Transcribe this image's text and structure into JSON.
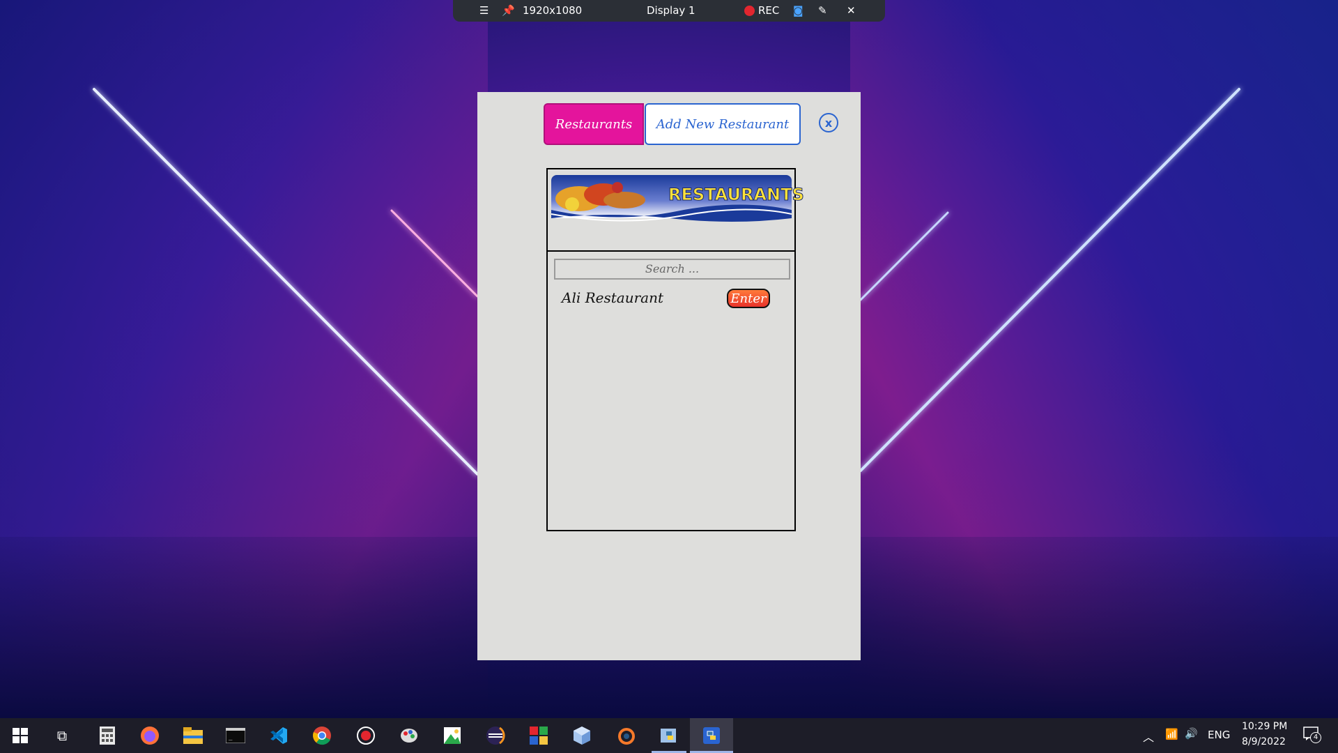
{
  "capture_bar": {
    "menu_icon": "hamburger-icon",
    "pin_icon": "pin-icon",
    "resolution": "1920x1080",
    "display": "Display 1",
    "rec_label": "REC",
    "camera_icon": "camera-icon",
    "pen_icon": "pen-icon",
    "close_icon": "close-icon"
  },
  "app": {
    "tabs": [
      {
        "label": "Restaurants",
        "active": true
      },
      {
        "label": "Add New Restaurant",
        "active": false
      }
    ],
    "close_label": "x",
    "banner_text": "RESTAURANTS",
    "search_placeholder": "Search ...",
    "restaurants": [
      {
        "name": "Ali Restaurant",
        "action": "Enter"
      }
    ],
    "colors": {
      "active_tab": "#e4149c",
      "accent_blue": "#2a64d0",
      "window_bg": "#dededc"
    }
  },
  "taskbar": {
    "icons": [
      "windows-start-icon",
      "task-view-icon",
      "calculator-icon",
      "firefox-icon",
      "file-explorer-icon",
      "terminal-icon",
      "vscode-icon",
      "chrome-icon",
      "record-icon",
      "paint-icon",
      "image-editor-icon",
      "eclipse-icon",
      "tiles-icon",
      "cube-icon",
      "blender-icon",
      "python-editor-icon",
      "python-app-icon"
    ],
    "tray": {
      "chevron_icon": "chevron-up-icon",
      "network_icon": "network-icon",
      "volume_icon": "volume-icon",
      "language": "ENG",
      "time": "10:29 PM",
      "date": "8/9/2022",
      "notifications": "4"
    }
  }
}
